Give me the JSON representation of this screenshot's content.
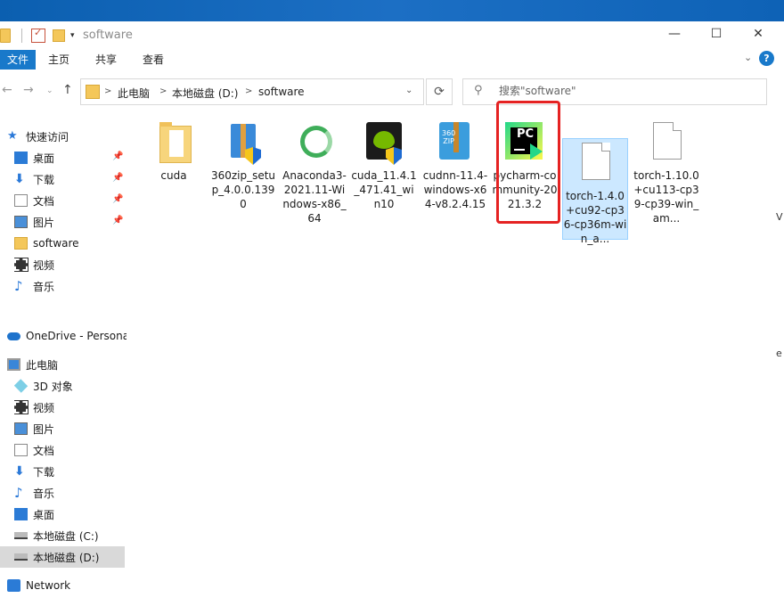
{
  "window": {
    "title": "software"
  },
  "ribbon": {
    "tabs": [
      "文件",
      "主页",
      "共享",
      "查看"
    ]
  },
  "address": {
    "crumbs": [
      "此电脑",
      "本地磁盘 (D:)",
      "software"
    ]
  },
  "search": {
    "placeholder": "搜索\"software\""
  },
  "nav": {
    "quick_access": "快速访问",
    "items": [
      {
        "label": "桌面",
        "icon": "desktop-icon"
      },
      {
        "label": "下载",
        "icon": "download-icon"
      },
      {
        "label": "文档",
        "icon": "documents-icon"
      },
      {
        "label": "图片",
        "icon": "pictures-icon"
      },
      {
        "label": "software",
        "icon": "folder-icon"
      },
      {
        "label": "视频",
        "icon": "videos-icon"
      },
      {
        "label": "音乐",
        "icon": "music-icon"
      }
    ],
    "onedrive": "OneDrive - Persona",
    "this_pc": "此电脑",
    "pc_items": [
      {
        "label": "3D 对象",
        "icon": "3d-objects-icon"
      },
      {
        "label": "视频",
        "icon": "videos-icon"
      },
      {
        "label": "图片",
        "icon": "pictures-icon"
      },
      {
        "label": "文档",
        "icon": "documents-icon"
      },
      {
        "label": "下载",
        "icon": "download-icon"
      },
      {
        "label": "音乐",
        "icon": "music-icon"
      },
      {
        "label": "桌面",
        "icon": "desktop-icon"
      },
      {
        "label": "本地磁盘 (C:)",
        "icon": "drive-icon"
      },
      {
        "label": "本地磁盘 (D:)",
        "icon": "drive-icon"
      }
    ],
    "network": "Network"
  },
  "files": [
    {
      "name": "cuda",
      "icon": "folder-icon"
    },
    {
      "name": "360zip_setup_4.0.0.1390",
      "icon": "installer-icon"
    },
    {
      "name": "Anaconda3-2021.11-Windows-x86_64",
      "icon": "anaconda-icon"
    },
    {
      "name": "cuda_11.4.1_471.41_win10",
      "icon": "nvidia-icon"
    },
    {
      "name": "cudnn-11.4-windows-x64-v8.2.4.15",
      "icon": "zip-icon"
    },
    {
      "name": "pycharm-community-2021.3.2",
      "icon": "pycharm-icon"
    },
    {
      "name": "torch-1.4.0+cu92-cp36-cp36m-win_a...",
      "icon": "file-icon"
    },
    {
      "name": "torch-1.10.0+cu113-cp39-cp39-win_am...",
      "icon": "file-icon"
    }
  ],
  "pycharm_badge": "PC",
  "zip_badge": "360\nZIP",
  "edge": {
    "chars": [
      "V",
      "e"
    ]
  },
  "colors": {
    "accent": "#1979ca",
    "highlight": "#e52222",
    "selection": "#cce8ff"
  }
}
